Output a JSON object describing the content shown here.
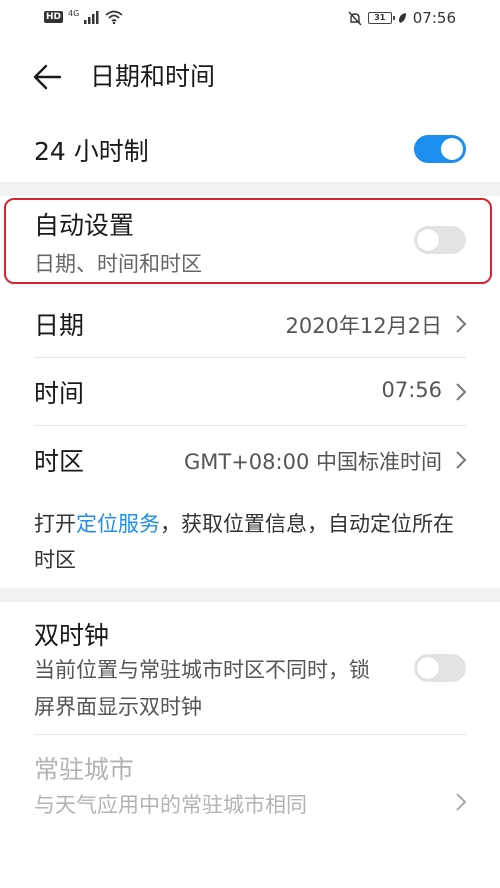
{
  "status_bar": {
    "hd": "HD",
    "network": "4G",
    "battery": "31",
    "time": "07:56"
  },
  "header": {
    "title": "日期和时间"
  },
  "settings": {
    "hour24": {
      "label": "24 小时制",
      "enabled": true
    },
    "auto_set": {
      "label": "自动设置",
      "subtitle": "日期、时间和时区",
      "enabled": false
    },
    "date": {
      "label": "日期",
      "value": "2020年12月2日"
    },
    "time": {
      "label": "时间",
      "value": "07:56"
    },
    "timezone": {
      "label": "时区",
      "value": "GMT+08:00 中国标准时间"
    },
    "location_note": {
      "prefix": "打开",
      "link": "定位服务",
      "suffix": "，获取位置信息，自动定位所在时区"
    },
    "dual_clock": {
      "label": "双时钟",
      "subtitle": "当前位置与常驻城市时区不同时，锁屏界面显示双时钟",
      "enabled": false
    },
    "home_city": {
      "label": "常驻城市",
      "subtitle": "与天气应用中的常驻城市相同"
    }
  },
  "colors": {
    "accent": "#1c8ef0",
    "highlight_border": "#d9232e"
  }
}
